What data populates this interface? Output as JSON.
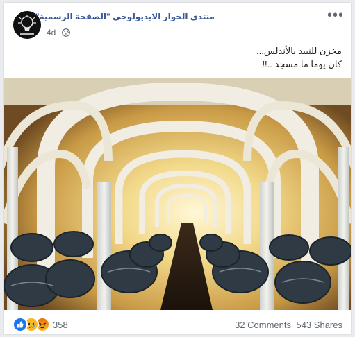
{
  "post": {
    "page_name": "منتدى الحوار الايديولوجي \"الصفحة الرسمية\"",
    "timestamp": "4d",
    "privacy_icon": "globe-icon",
    "more_icon": "more-options-icon",
    "text_line1": "مخزن للنبيذ بالأندلس...",
    "text_line2": "كان يوما ما مسجد ..!!"
  },
  "photo": {
    "description_icon": "photo-wine-cellar-arches"
  },
  "footer": {
    "reaction_icons": [
      "like-icon",
      "sad-icon",
      "angry-icon"
    ],
    "reaction_count": "358",
    "comments": "32 Comments",
    "shares": "543 Shares"
  },
  "colors": {
    "link_blue": "#385898",
    "meta_gray": "#606770",
    "like_blue": "#1877f2",
    "card_border": "#dddfe2",
    "page_bg": "#e9ebee"
  }
}
